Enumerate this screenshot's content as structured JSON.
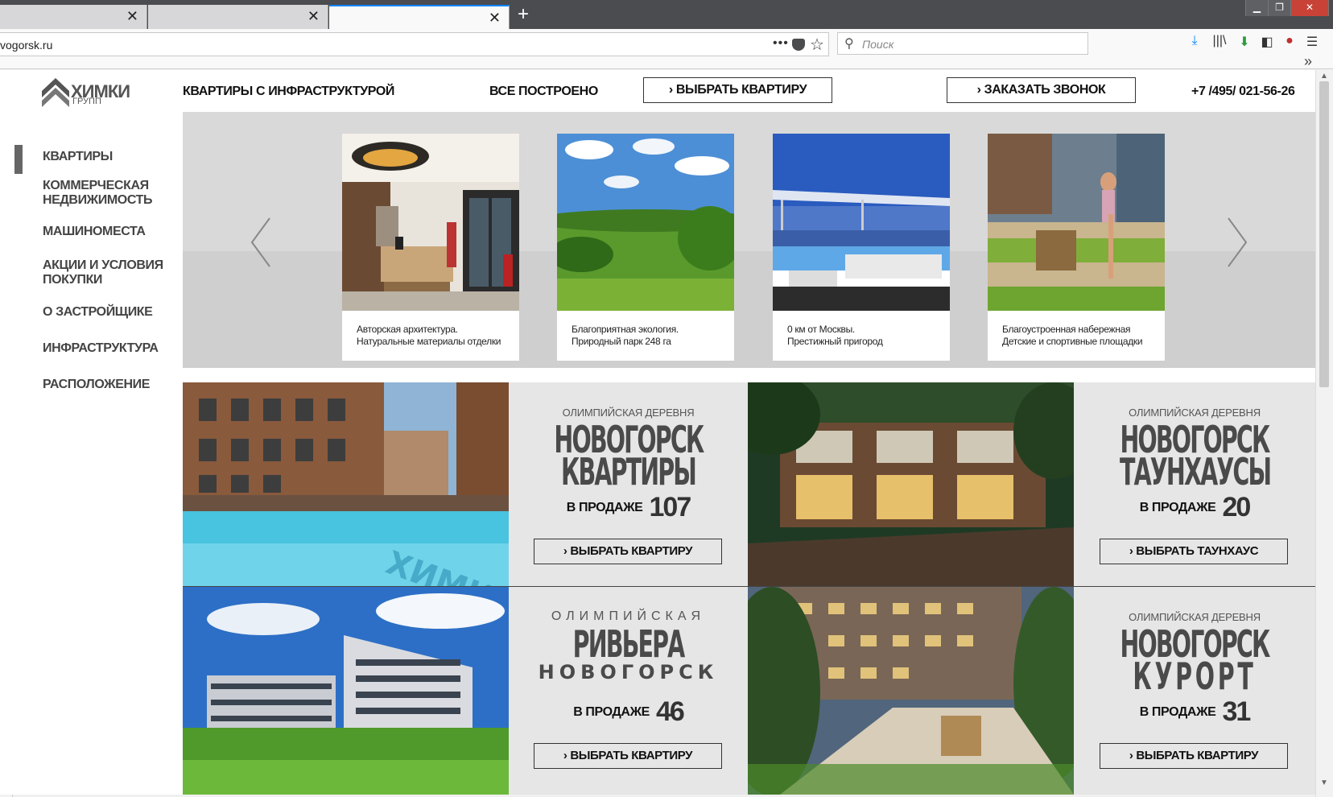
{
  "browser": {
    "tabs": [
      {
        "title": "",
        "close": "✕"
      },
      {
        "title": "",
        "close": "✕"
      },
      {
        "title": "",
        "close": "✕"
      }
    ],
    "new_tab": "+",
    "url": "vogorsk.ru",
    "url_menu": "•••",
    "search_placeholder": "Поиск",
    "overflow": "»",
    "window_controls": {
      "minimize": "▁",
      "maximize": "❐",
      "close": "✕"
    }
  },
  "site": {
    "logo": {
      "brand": "ХИМКИ",
      "sub": "ГРУПП"
    },
    "nav": {
      "infra": "КВАРТИРЫ С ИНФРАСТРУКТУРОЙ",
      "built": "ВСЕ ПОСТРОЕНО",
      "choose": "ВЫБРАТЬ КВАРТИРУ",
      "callback": "ЗАКАЗАТЬ ЗВОНОК",
      "phone": "+7 /495/ 021-56-26",
      "chevron": "›"
    },
    "sidebar": [
      "КВАРТИРЫ",
      "КОММЕРЧЕСКАЯ НЕДВИЖИМОСТЬ",
      "МАШИНОМЕСТА",
      "АКЦИИ И УСЛОВИЯ ПОКУПКИ",
      "О ЗАСТРОЙЩИКЕ",
      "ИНФРАСТРУКТУРА",
      "РАСПОЛОЖЕНИЕ"
    ],
    "carousel": [
      {
        "line1": "Авторская архитектура.",
        "line2": "Натуральные материалы отделки"
      },
      {
        "line1": "Благоприятная экология.",
        "line2": "Природный парк 248 га"
      },
      {
        "line1": "0 км от Москвы.",
        "line2": "Престижный пригород"
      },
      {
        "line1": "Благоустроенная набережная",
        "line2": "Детские и спортивные площадки"
      }
    ],
    "projects": [
      {
        "kicker": "ОЛИМПИЙСКАЯ ДЕРЕВНЯ",
        "t1": "НОВОГОРСК",
        "t2": "КВАРТИРЫ",
        "sale_label": "В ПРОДАЖЕ",
        "count": "107",
        "button": "ВЫБРАТЬ КВАРТИРУ"
      },
      {
        "kicker": "ОЛИМПИЙСКАЯ ДЕРЕВНЯ",
        "t1": "НОВОГОРСК",
        "t2": "ТАУНХАУСЫ",
        "sale_label": "В ПРОДАЖЕ",
        "count": "20",
        "button": "ВЫБРАТЬ ТАУНХАУС"
      },
      {
        "kicker": "ОЛИМПИЙСКАЯ",
        "t1": "РИВЬЕРА",
        "t2": "НОВОГОРСК",
        "sale_label": "В ПРОДАЖЕ",
        "count": "46",
        "button": "ВЫБРАТЬ КВАРТИРУ"
      },
      {
        "kicker": "ОЛИМПИЙСКАЯ ДЕРЕВНЯ",
        "t1": "НОВОГОРСК",
        "t2": "КУРОРТ",
        "sale_label": "В ПРОДАЖЕ",
        "count": "31",
        "button": "ВЫБРАТЬ КВАРТИРУ"
      }
    ]
  },
  "colors": {
    "tabbar": "#4a4c4f",
    "accent_tab": "#0a84ff",
    "carousel_bg": "#d9d9d9",
    "grid_bg": "#e6e6e6",
    "title_text": "#4a4a4a"
  }
}
